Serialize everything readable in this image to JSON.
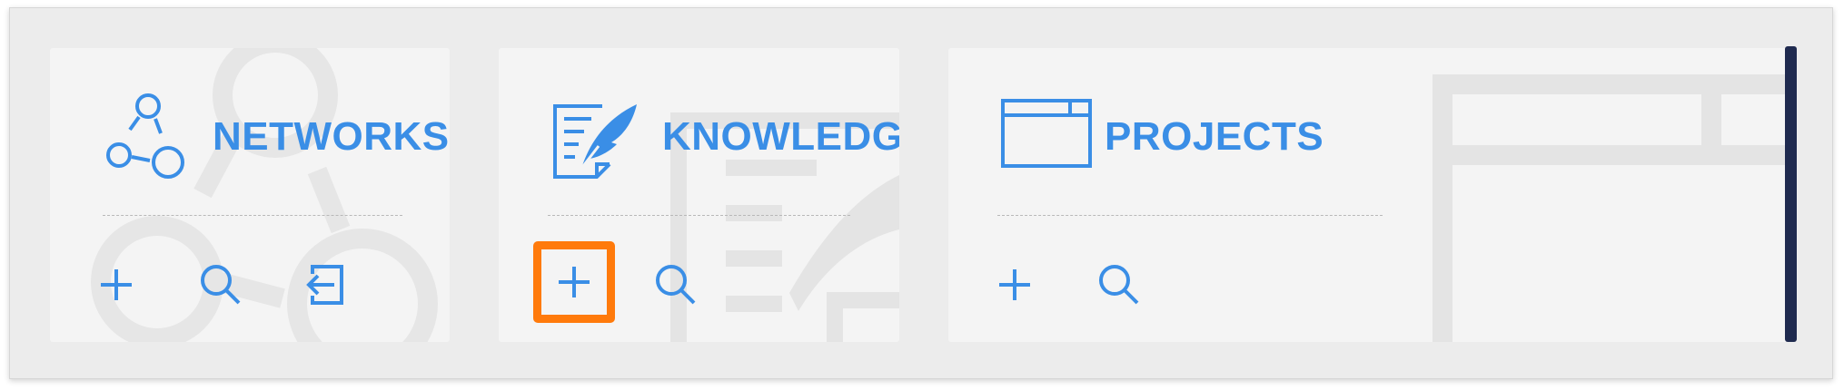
{
  "theme": {
    "accent": "#3a8ee6",
    "highlight": "#ff7a0b",
    "card_background": "#f4f4f4",
    "frame_background": "#ececec",
    "scrollbar": "#1f2a4f"
  },
  "cards": {
    "networks": {
      "title": "NETWORKS",
      "icon": "network-nodes-icon",
      "actions": [
        {
          "icon": "plus-icon",
          "selected": false
        },
        {
          "icon": "search-icon",
          "selected": false
        },
        {
          "icon": "import-icon",
          "selected": false
        }
      ]
    },
    "knowledge": {
      "title": "KNOWLEDGE",
      "icon": "document-quill-icon",
      "actions": [
        {
          "icon": "plus-icon",
          "selected": true
        },
        {
          "icon": "search-icon",
          "selected": false
        }
      ]
    },
    "projects": {
      "title": "PROJECTS",
      "icon": "window-icon",
      "actions": [
        {
          "icon": "plus-icon",
          "selected": false
        },
        {
          "icon": "search-icon",
          "selected": false
        }
      ]
    }
  }
}
